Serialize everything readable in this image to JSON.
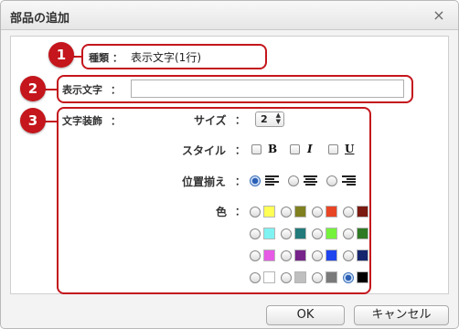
{
  "dialog": {
    "title": "部品の追加",
    "close_glyph": "×"
  },
  "markers": [
    "1",
    "2",
    "3"
  ],
  "accent_color": "#c4161c",
  "row_type": {
    "label": "種類",
    "colon": "：",
    "value": "表示文字(1行)"
  },
  "row_text": {
    "label": "表示文字",
    "colon": "：",
    "value": ""
  },
  "row_decoration": {
    "label": "文字装飾",
    "colon": "："
  },
  "size": {
    "label": "サイズ",
    "colon": "：",
    "value": "2"
  },
  "style": {
    "label": "スタイル",
    "colon": "：",
    "bold": "B",
    "italic": "I",
    "underline": "U"
  },
  "align": {
    "label": "位置揃え",
    "colon": "：",
    "selected": "left"
  },
  "color": {
    "label": "色",
    "colon": "：",
    "selected": "#000000",
    "swatches": [
      "#ffff55",
      "#808020",
      "#e84525",
      "#7a1a10",
      "#7ff2f2",
      "#237a7a",
      "#75f23c",
      "#2e7a24",
      "#e65ae6",
      "#76248a",
      "#1f45ee",
      "#16266e",
      "#ffffff",
      "#bfbfbf",
      "#7a7a7a",
      "#000000"
    ]
  },
  "buttons": {
    "ok": "OK",
    "cancel": "キャンセル"
  }
}
